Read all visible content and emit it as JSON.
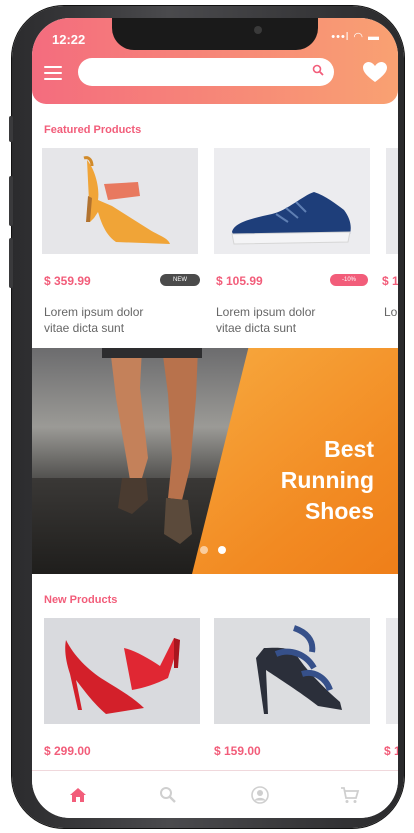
{
  "status_bar": {
    "time": "12:22",
    "icons": "•••l ◠ ▬"
  },
  "header": {
    "search": {
      "placeholder": "",
      "value": ""
    },
    "brand_gradient": [
      "#f46c7e",
      "#f9a172"
    ]
  },
  "featured": {
    "title": "Featured Products",
    "products": [
      {
        "price": "$ 359.99",
        "badge": "NEW",
        "desc_line1": "Lorem ipsum dolor",
        "desc_line2": "vitae dicta sunt"
      },
      {
        "price": "$ 105.99",
        "badge": "-10%",
        "desc_line1": "Lorem ipsum dolor",
        "desc_line2": "vitae dicta sunt"
      },
      {
        "price": "$ 1",
        "desc_line1": "Lo"
      }
    ]
  },
  "banner": {
    "line1": "Best",
    "line2": "Running",
    "line3": "Shoes"
  },
  "new_products": {
    "title": "New Products",
    "products": [
      {
        "price": "$ 299.00"
      },
      {
        "price": "$ 159.00"
      },
      {
        "price": "$ 1"
      }
    ]
  },
  "tab_bar": {
    "items": [
      "home-icon",
      "search-icon",
      "profile-icon",
      "cart-icon"
    ],
    "active_color": "#f25d7a",
    "inactive_color": "#cfcfcf"
  }
}
